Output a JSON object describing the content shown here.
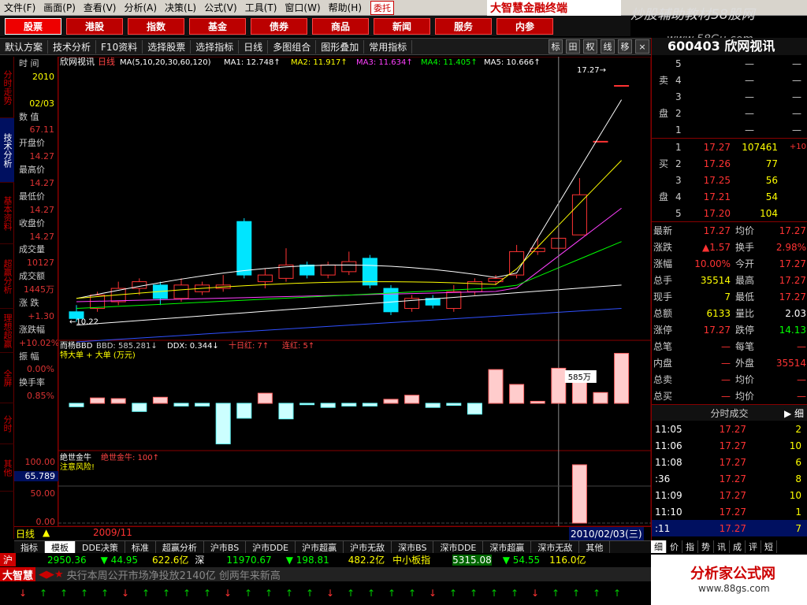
{
  "menu": [
    "文件(F)",
    "画面(P)",
    "查看(V)",
    "分析(A)",
    "决策(L)",
    "公式(V)",
    "工具(T)",
    "窗口(W)",
    "帮助(H)"
  ],
  "menu_tag": "委托",
  "brand": "大智慧金融终端",
  "watermark_top": "炒股辅助教材58股网",
  "watermark_url": "www.58Gu.com",
  "nav": [
    "股票",
    "港股",
    "指数",
    "基金",
    "债券",
    "商品",
    "新闻",
    "服务",
    "内参"
  ],
  "toolbar": [
    "默认方案",
    "技术分析",
    "F10资料",
    "选择股票",
    "选择指标",
    "日线",
    "多图组合",
    "图形叠加",
    "常用指标"
  ],
  "toolbar_icons": [
    "标",
    "田",
    "权",
    "线",
    "移"
  ],
  "stock_header": "600403 欣网视讯",
  "left_tabs": [
    "分时走势",
    "技术分析",
    "基本资料",
    "超赢分析",
    "理想超赢",
    "全屏",
    "分时",
    "其他"
  ],
  "info_panel": [
    {
      "label": "时  间",
      "value": "2010"
    },
    {
      "label": "",
      "value": "02/03"
    },
    {
      "label": "数  值",
      "value": "67.11"
    },
    {
      "label": "开盘价",
      "value": "14.27"
    },
    {
      "label": "最高价",
      "value": "14.27"
    },
    {
      "label": "最低价",
      "value": "14.27"
    },
    {
      "label": "收盘价",
      "value": "14.27"
    },
    {
      "label": "成交量",
      "value": "10127"
    },
    {
      "label": "成交额",
      "value": "1445万"
    },
    {
      "label": "涨  跌",
      "value": "+1.30"
    },
    {
      "label": "涨跌幅",
      "value": "+10.02%"
    },
    {
      "label": "振  幅",
      "value": "0.00%"
    },
    {
      "label": "换手率",
      "value": "0.85%"
    }
  ],
  "chart_header": {
    "name": "欣网视讯",
    "period": "日线",
    "ma": "MA(5,10,20,30,60,120)",
    "ma1": "MA1: 12.748↑",
    "ma2": "MA2: 11.917↑",
    "ma3": "MA3: 11.634↑",
    "ma4": "MA4: 11.405↑",
    "ma5": "MA5: 10.666↑"
  },
  "price_annotations": {
    "low_label": "←10.22",
    "high_label": "17.27→",
    "price_axis_top": "17.8"
  },
  "bbd_header": {
    "title": "而杨BBD",
    "bbd": "BBD: 585.281↓",
    "ddx": "DDX: 0.344↓",
    "ten_day": "十日红: 7↑",
    "consec": "连红: 5↑",
    "sub": "特大单 + 大单 (万元)",
    "bubble": "585万",
    "axis_low": "-967"
  },
  "third_panel": {
    "title": "绝世金牛",
    "value": "绝世金牛: 100↑",
    "warn": "注意风险!",
    "axis": [
      "100.00",
      "65.789",
      "50.00",
      "0.00"
    ]
  },
  "date_line": {
    "period": "日线",
    "start": "2009/11",
    "end": "2010/02/03(三)"
  },
  "bottom_tabs": [
    "指标",
    "模板",
    "DDE决策",
    "标准",
    "超赢分析",
    "沪市BS",
    "沪市DDE",
    "沪市超赢",
    "沪市无敌",
    "深市BS",
    "深市DDE",
    "深市超赢",
    "深市无敌",
    "其他"
  ],
  "index_bar": {
    "sh_label": "沪",
    "sh_val": "2950.36",
    "sh_chg": "▼ 44.95",
    "sh_amt": "622.6亿",
    "sz_label": "深",
    "sz_val": "11970.67",
    "sz_chg": "▼ 198.81",
    "sz_amt": "482.2亿",
    "zx_label": "中小板指",
    "zx_val": "5315.08",
    "zx_chg": "▼ 54.55",
    "zx_amt": "116.0亿"
  },
  "ticker": "央行本周公开市场净投放2140亿 创两年来新高",
  "logo_small": "大智慧",
  "order_book": {
    "sell": [
      {
        "n": "5",
        "p": "—",
        "v": "—"
      },
      {
        "n": "4",
        "p": "—",
        "v": "—"
      },
      {
        "n": "3",
        "p": "—",
        "v": "—"
      },
      {
        "n": "2",
        "p": "—",
        "v": "—"
      },
      {
        "n": "1",
        "p": "—",
        "v": "—"
      }
    ],
    "buy": [
      {
        "n": "1",
        "p": "17.27",
        "v": "107461",
        "x": "+10"
      },
      {
        "n": "2",
        "p": "17.26",
        "v": "77",
        "x": ""
      },
      {
        "n": "3",
        "p": "17.25",
        "v": "56",
        "x": ""
      },
      {
        "n": "4",
        "p": "17.21",
        "v": "54",
        "x": ""
      },
      {
        "n": "5",
        "p": "17.20",
        "v": "104",
        "x": ""
      }
    ],
    "sell_label": [
      "卖",
      "盘"
    ],
    "buy_label": [
      "买",
      "盘"
    ]
  },
  "quote": [
    {
      "l": "最新",
      "v": "17.27",
      "l2": "均价",
      "v2": "17.27"
    },
    {
      "l": "涨跌",
      "v": "▲1.57",
      "l2": "换手",
      "v2": "2.98%"
    },
    {
      "l": "涨幅",
      "v": "10.00%",
      "l2": "今开",
      "v2": "17.27"
    },
    {
      "l": "总手",
      "v": "35514",
      "l2": "最高",
      "v2": "17.27"
    },
    {
      "l": "现手",
      "v": "7",
      "l2": "最低",
      "v2": "17.27"
    },
    {
      "l": "总额",
      "v": "6133",
      "l2": "量比",
      "v2": "2.03"
    },
    {
      "l": "涨停",
      "v": "17.27",
      "l2": "跌停",
      "v2": "14.13"
    },
    {
      "l": "总笔",
      "v": "—",
      "l2": "每笔",
      "v2": "—"
    },
    {
      "l": "内盘",
      "v": "—",
      "l2": "外盘",
      "v2": "35514"
    },
    {
      "l": "总卖",
      "v": "—",
      "l2": "均价",
      "v2": "—"
    },
    {
      "l": "总买",
      "v": "—",
      "l2": "均价",
      "v2": "—"
    }
  ],
  "ticks_title": "分时成交",
  "ticks_btn": "细",
  "ticks": [
    {
      "t": "11:05",
      "p": "17.27",
      "v": "2"
    },
    {
      "t": "11:06",
      "p": "17.27",
      "v": "10"
    },
    {
      "t": "11:08",
      "p": "17.27",
      "v": "6"
    },
    {
      "t": ":36",
      "p": "17.27",
      "v": "8"
    },
    {
      "t": "11:09",
      "p": "17.27",
      "v": "10"
    },
    {
      "t": "11:10",
      "p": "17.27",
      "v": "1"
    },
    {
      "t": ":11",
      "p": "17.27",
      "v": "7"
    }
  ],
  "right_tabs": [
    "细",
    "价",
    "指",
    "势",
    "讯",
    "成",
    "评",
    "短"
  ],
  "logo2_text": "分析家公式网",
  "logo2_url": "www.88gs.com",
  "colors": {
    "up": "#ff3333",
    "down": "#00e5ff",
    "ma1": "#ffffff",
    "ma2": "#ffff00",
    "ma3": "#ff40ff",
    "ma4": "#00ff00",
    "ma5": "#ffffff",
    "ma6": "#3050ff"
  },
  "chart_data": {
    "type": "candlestick",
    "candles": [
      {
        "o": 10.5,
        "c": 10.3,
        "h": 10.7,
        "l": 10.2
      },
      {
        "o": 10.6,
        "c": 11.0,
        "h": 11.1,
        "l": 10.5
      },
      {
        "o": 10.8,
        "c": 11.2,
        "h": 11.4,
        "l": 10.7
      },
      {
        "o": 11.2,
        "c": 11.4,
        "h": 11.5,
        "l": 11.0
      },
      {
        "o": 11.3,
        "c": 10.9,
        "h": 11.4,
        "l": 10.7
      },
      {
        "o": 10.9,
        "c": 11.3,
        "h": 11.5,
        "l": 10.8
      },
      {
        "o": 11.1,
        "c": 11.3,
        "h": 11.4,
        "l": 11.0
      },
      {
        "o": 11.2,
        "c": 11.3,
        "h": 11.6,
        "l": 11.1
      },
      {
        "o": 13.2,
        "c": 11.6,
        "h": 13.3,
        "l": 11.5
      },
      {
        "o": 11.4,
        "c": 11.6,
        "h": 11.8,
        "l": 11.2
      },
      {
        "o": 11.5,
        "c": 11.9,
        "h": 12.4,
        "l": 11.4
      },
      {
        "o": 11.9,
        "c": 11.6,
        "h": 12.0,
        "l": 11.5
      },
      {
        "o": 11.6,
        "c": 11.9,
        "h": 12.0,
        "l": 11.5
      },
      {
        "o": 11.7,
        "c": 12.0,
        "h": 12.3,
        "l": 11.6
      },
      {
        "o": 12.1,
        "c": 11.3,
        "h": 12.2,
        "l": 11.2
      },
      {
        "o": 11.2,
        "c": 10.5,
        "h": 11.3,
        "l": 10.4
      },
      {
        "o": 10.6,
        "c": 10.9,
        "h": 11.0,
        "l": 10.5
      },
      {
        "o": 10.9,
        "c": 10.7,
        "h": 11.0,
        "l": 10.6
      },
      {
        "o": 10.6,
        "c": 11.1,
        "h": 11.3,
        "l": 10.5
      },
      {
        "o": 11.1,
        "c": 11.4,
        "h": 11.5,
        "l": 11.0
      },
      {
        "o": 11.4,
        "c": 11.5,
        "h": 11.6,
        "l": 11.3
      },
      {
        "o": 11.6,
        "c": 12.3,
        "h": 12.5,
        "l": 11.5
      },
      {
        "o": 12.3,
        "c": 12.4,
        "h": 12.7,
        "l": 12.2
      },
      {
        "o": 12.4,
        "c": 12.7,
        "h": 13.0,
        "l": 12.3
      },
      {
        "o": 12.8,
        "c": 14.0,
        "h": 14.5,
        "l": 12.8
      },
      {
        "o": 15.6,
        "c": 15.6,
        "h": 15.6,
        "l": 15.6
      },
      {
        "o": 17.27,
        "c": 17.27,
        "h": 17.27,
        "l": 17.27
      }
    ],
    "bbd": [
      -50,
      80,
      70,
      -120,
      90,
      -40,
      -40,
      -600,
      -220,
      150,
      -230,
      -20,
      -60,
      -40,
      -40,
      60,
      120,
      -60,
      -30,
      -160,
      500,
      280,
      30,
      520,
      380,
      160,
      740
    ],
    "third": [
      0,
      0,
      0,
      0,
      0,
      0,
      0,
      0,
      0,
      0,
      0,
      0,
      0,
      0,
      0,
      0,
      0,
      0,
      0,
      0,
      0,
      0,
      0,
      0,
      100,
      0,
      0
    ],
    "price_axis": [
      10.22,
      17.8
    ],
    "bbd_axis": [
      -967,
      800
    ]
  }
}
